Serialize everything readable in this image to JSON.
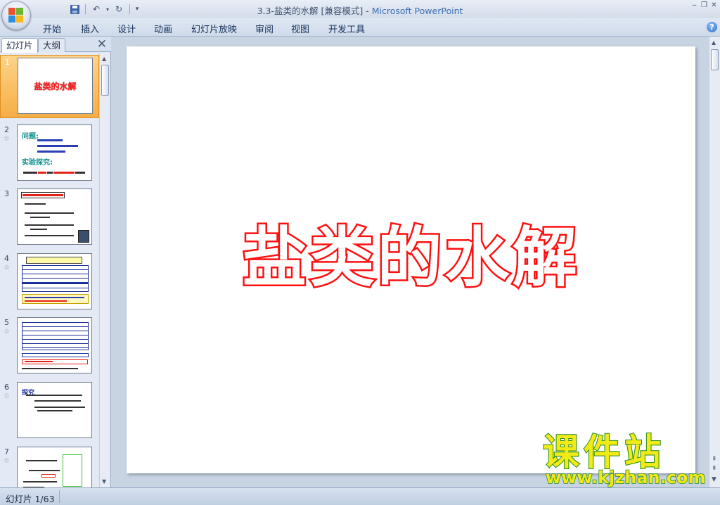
{
  "window": {
    "title": "3.3-盐类的水解 [兼容模式]",
    "title_sep": " - ",
    "app_name": "Microsoft PowerPoint",
    "controls": [
      "‒",
      "❐",
      "✕"
    ]
  },
  "qat": {
    "undo": "↶",
    "redo": "↻",
    "more": "▾",
    "dropdown": "▾"
  },
  "ribbon": {
    "tabs": [
      "开始",
      "插入",
      "设计",
      "动画",
      "幻灯片放映",
      "审阅",
      "视图",
      "开发工具"
    ],
    "help": "?"
  },
  "panel": {
    "tab_slides": "幻灯片",
    "tab_outline": "大纲",
    "close": "✕"
  },
  "thumbnails": [
    {
      "num": "1",
      "title": "盐类的水解"
    },
    {
      "num": "2",
      "heading1": "问题:",
      "heading2": "实验探究:"
    },
    {
      "num": "3"
    },
    {
      "num": "4"
    },
    {
      "num": "5"
    },
    {
      "num": "6",
      "heading1": "探究"
    },
    {
      "num": "7"
    }
  ],
  "slide": {
    "title": "盐类的水解"
  },
  "watermark": {
    "main": "课件站",
    "url": "www.kjzhan.com"
  },
  "status": {
    "slide_info": "幻灯片 1/63"
  },
  "colors": {
    "accent": "#3b6fb6",
    "title_stroke": "#ff0f0f",
    "selected_thumb": "#f5ae46"
  }
}
